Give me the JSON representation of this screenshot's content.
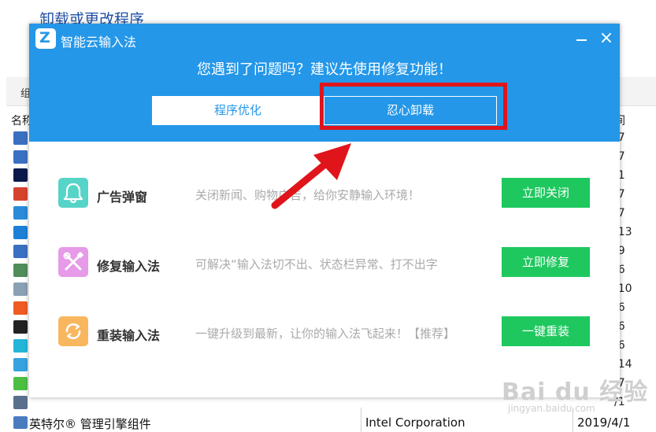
{
  "background": {
    "title": "卸载或更改程序",
    "toolbar_label": "组",
    "col_name": "名称",
    "col_date": "间",
    "row_dates": [
      "/7",
      "/7",
      "/1",
      "/7",
      "/7",
      "/13",
      "/9",
      "/6",
      "/10",
      "/6",
      "/6",
      "/6",
      "/14",
      "/7",
      "/1"
    ],
    "last_row": {
      "name": "英特尔® 管理引擎组件",
      "publisher": "Intel Corporation",
      "date": "2019/4/1"
    }
  },
  "dialog": {
    "app_name": "智能云输入法",
    "logo_glyph": "Z",
    "close_glyph": "×",
    "question": "您遇到了问题吗？建议先使用修复功能！",
    "tabs": [
      {
        "label": "程序优化",
        "active": false
      },
      {
        "label": "忍心卸载",
        "active": true
      }
    ],
    "options": [
      {
        "title": "广告弹窗",
        "desc": "关闭新闻、购物广告，给你安静输入环境！",
        "button": "立即关闭",
        "icon": "bell-icon",
        "icon_color": "#56d4c8"
      },
      {
        "title": "修复输入法",
        "desc": "可解决“输入法切不出、状态栏异常、打不出字",
        "button": "立即修复",
        "icon": "tools-icon",
        "icon_color": "#e69ae8"
      },
      {
        "title": "重装输入法",
        "desc": "一键升级到最新，让你的输入法飞起来！【推荐】",
        "button": "一键重装",
        "icon": "refresh-icon",
        "icon_color": "#f8b75f"
      }
    ],
    "colors": {
      "header": "#2497e8",
      "button": "#1ec85e",
      "highlight": "#e0141b"
    }
  },
  "watermark": {
    "brand": "Bai du 经验",
    "url": "jingyan.baidu.com"
  }
}
